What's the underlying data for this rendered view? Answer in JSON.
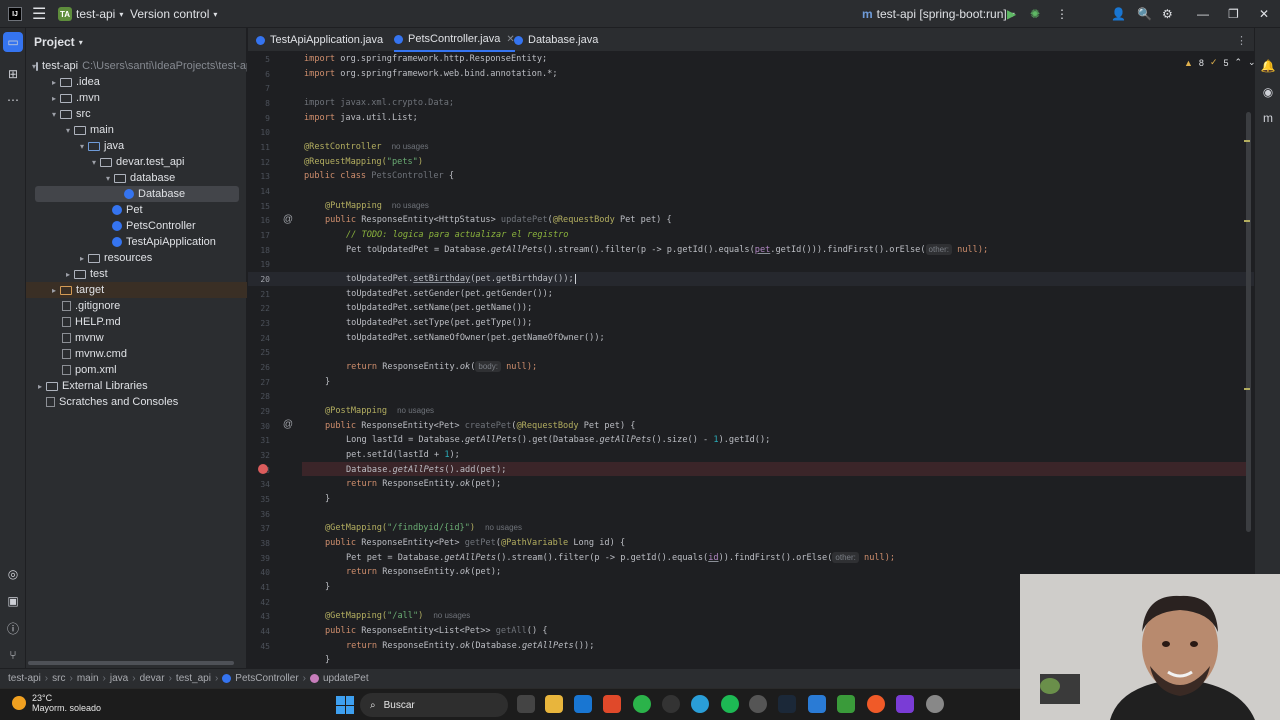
{
  "titlebar": {
    "project_badge": "TA",
    "project_name": "test-api",
    "vcs_label": "Version control",
    "run_config": "test-api [spring-boot:run]"
  },
  "project_panel": {
    "title": "Project",
    "tree": [
      {
        "label": "test-api",
        "hint": "C:\\Users\\santi\\IdeaProjects\\test-api",
        "kind": "module"
      },
      {
        "label": ".idea",
        "kind": "folder"
      },
      {
        "label": ".mvn",
        "kind": "folder"
      },
      {
        "label": "src",
        "kind": "folder"
      },
      {
        "label": "main",
        "kind": "folder"
      },
      {
        "label": "java",
        "kind": "src"
      },
      {
        "label": "devar.test_api",
        "kind": "folder"
      },
      {
        "label": "database",
        "kind": "folder"
      },
      {
        "label": "Database",
        "kind": "class"
      },
      {
        "label": "Pet",
        "kind": "class"
      },
      {
        "label": "PetsController",
        "kind": "class"
      },
      {
        "label": "TestApiApplication",
        "kind": "class"
      },
      {
        "label": "resources",
        "kind": "folder"
      },
      {
        "label": "test",
        "kind": "folder"
      },
      {
        "label": "target",
        "kind": "target"
      },
      {
        "label": ".gitignore",
        "kind": "file"
      },
      {
        "label": "HELP.md",
        "kind": "file"
      },
      {
        "label": "mvnw",
        "kind": "file"
      },
      {
        "label": "mvnw.cmd",
        "kind": "file"
      },
      {
        "label": "pom.xml",
        "kind": "file"
      },
      {
        "label": "External Libraries",
        "kind": "lib"
      },
      {
        "label": "Scratches and Consoles",
        "kind": "scratch"
      }
    ]
  },
  "tabs": [
    {
      "label": "TestApiApplication.java"
    },
    {
      "label": "PetsController.java"
    },
    {
      "label": "Database.java"
    }
  ],
  "inspections": {
    "warnings": "8",
    "weak": "5"
  },
  "code": {
    "line_numbers": [
      "5",
      "6",
      "7",
      "8",
      "9",
      "10",
      "11",
      "12",
      "13",
      "14",
      "15",
      "16",
      "17",
      "18",
      "19",
      "20",
      "21",
      "22",
      "23",
      "24",
      "25",
      "26",
      "27",
      "28",
      "29",
      "30",
      "31",
      "32",
      "33",
      "34",
      "35",
      "36",
      "37",
      "38",
      "39",
      "40",
      "41",
      "42",
      "43",
      "44",
      "45"
    ],
    "imp1_a": "import ",
    "imp1_b": "org.springframework.http.ResponseEntity;",
    "imp2_a": "import ",
    "imp2_b": "org.springframework.web.bind.annotation.*;",
    "imp3": "import javax.xml.crypto.Data;",
    "imp4_a": "import ",
    "imp4_b": "java.util.List;",
    "rc": "@RestController",
    "no_usages": "no usages",
    "rm_a": "@RequestMapping(",
    "rm_b": "\"pets\"",
    "rm_c": ")",
    "cls_a": "public class ",
    "cls_b": "PetsController",
    "cls_c": " {",
    "put": "@PutMapping",
    "upd_a": "public ",
    "upd_b": "ResponseEntity<HttpStatus> ",
    "upd_c": "updatePet",
    "upd_d": "(",
    "upd_e": "@RequestBody",
    "upd_f": " Pet pet) {",
    "todo": "// TODO: logica para actualizar el registro",
    "find_a": "Pet toUpdatedPet = Database.",
    "find_b": "getAllPets",
    "find_c": "().stream().filter(p -> p.getId().equals(",
    "find_d": "pet",
    "find_e": ".getId())).findFirst().orElse(",
    "find_hint": "other:",
    "find_f": " null);",
    "set1_a": "toUpdatedPet.",
    "set1_b": "setBirthday",
    "set1_c": "(pet.getBirthday());",
    "set2": "toUpdatedPet.setGender(pet.getGender());",
    "set3": "toUpdatedPet.setName(pet.getName());",
    "set4": "toUpdatedPet.setType(pet.getType());",
    "set5": "toUpdatedPet.setNameOfOwner(pet.getNameOfOwner());",
    "ret1_a": "return ",
    "ret1_b": "ResponseEntity.",
    "ret1_c": "ok",
    "ret1_d": "(",
    "ret1_hint": "body:",
    "ret1_e": " null);",
    "close": "}",
    "post": "@PostMapping",
    "cr_a": "public ",
    "cr_b": "ResponseEntity<Pet> ",
    "cr_c": "createPet",
    "cr_d": "(",
    "cr_e": "@RequestBody",
    "cr_f": " Pet pet) {",
    "lid_a": "Long lastId = Database.",
    "lid_b": "getAllPets",
    "lid_c": "().get(Database.",
    "lid_d": "getAllPets",
    "lid_e": "().size() - ",
    "lid_f": "1",
    "lid_g": ").getId();",
    "setid_a": "pet.setId(lastId + ",
    "setid_b": "1",
    "setid_c": ");",
    "add_a": "Database.",
    "add_b": "getAllPets",
    "add_c": "().add(pet);",
    "ret2_a": "return ",
    "ret2_b": "ResponseEntity.",
    "ret2_c": "ok",
    "ret2_d": "(pet);",
    "get1_a": "@GetMapping(",
    "get1_b": "\"/findbyid/{id}\"",
    "get1_c": ")",
    "gp_a": "public ",
    "gp_b": "ResponseEntity<Pet> ",
    "gp_c": "getPet",
    "gp_d": "(",
    "gp_e": "@PathVariable",
    "gp_f": " Long id) {",
    "gpl_a": "Pet pet = Database.",
    "gpl_b": "getAllPets",
    "gpl_c": "().stream().filter(p -> p.getId().equals(",
    "gpl_d": "id",
    "gpl_e": ")).findFirst().orElse(",
    "gpl_hint": "other:",
    "gpl_f": " null);",
    "ret3_a": "return ",
    "ret3_b": "ResponseEntity.",
    "ret3_c": "ok",
    "ret3_d": "(pet);",
    "get2_a": "@GetMapping(",
    "get2_b": "\"/all\"",
    "get2_c": ")",
    "ga_a": "public ",
    "ga_b": "ResponseEntity<List<Pet>> ",
    "ga_c": "getAll",
    "ga_d": "() {",
    "ret4_a": "return ",
    "ret4_b": "ResponseEntity.",
    "ret4_c": "ok",
    "ret4_d": "(Database.",
    "ret4_e": "getAllPets",
    "ret4_f": "());"
  },
  "breadcrumb": [
    "test-api",
    "src",
    "main",
    "java",
    "devar",
    "test_api",
    "PetsController",
    "updatePet"
  ],
  "taskbar": {
    "temperature": "23°C",
    "weather": "Mayorm. soleado",
    "search": "Buscar"
  },
  "colors": {
    "accent": "#3574f0",
    "breakpoint": "#db5c5c"
  }
}
